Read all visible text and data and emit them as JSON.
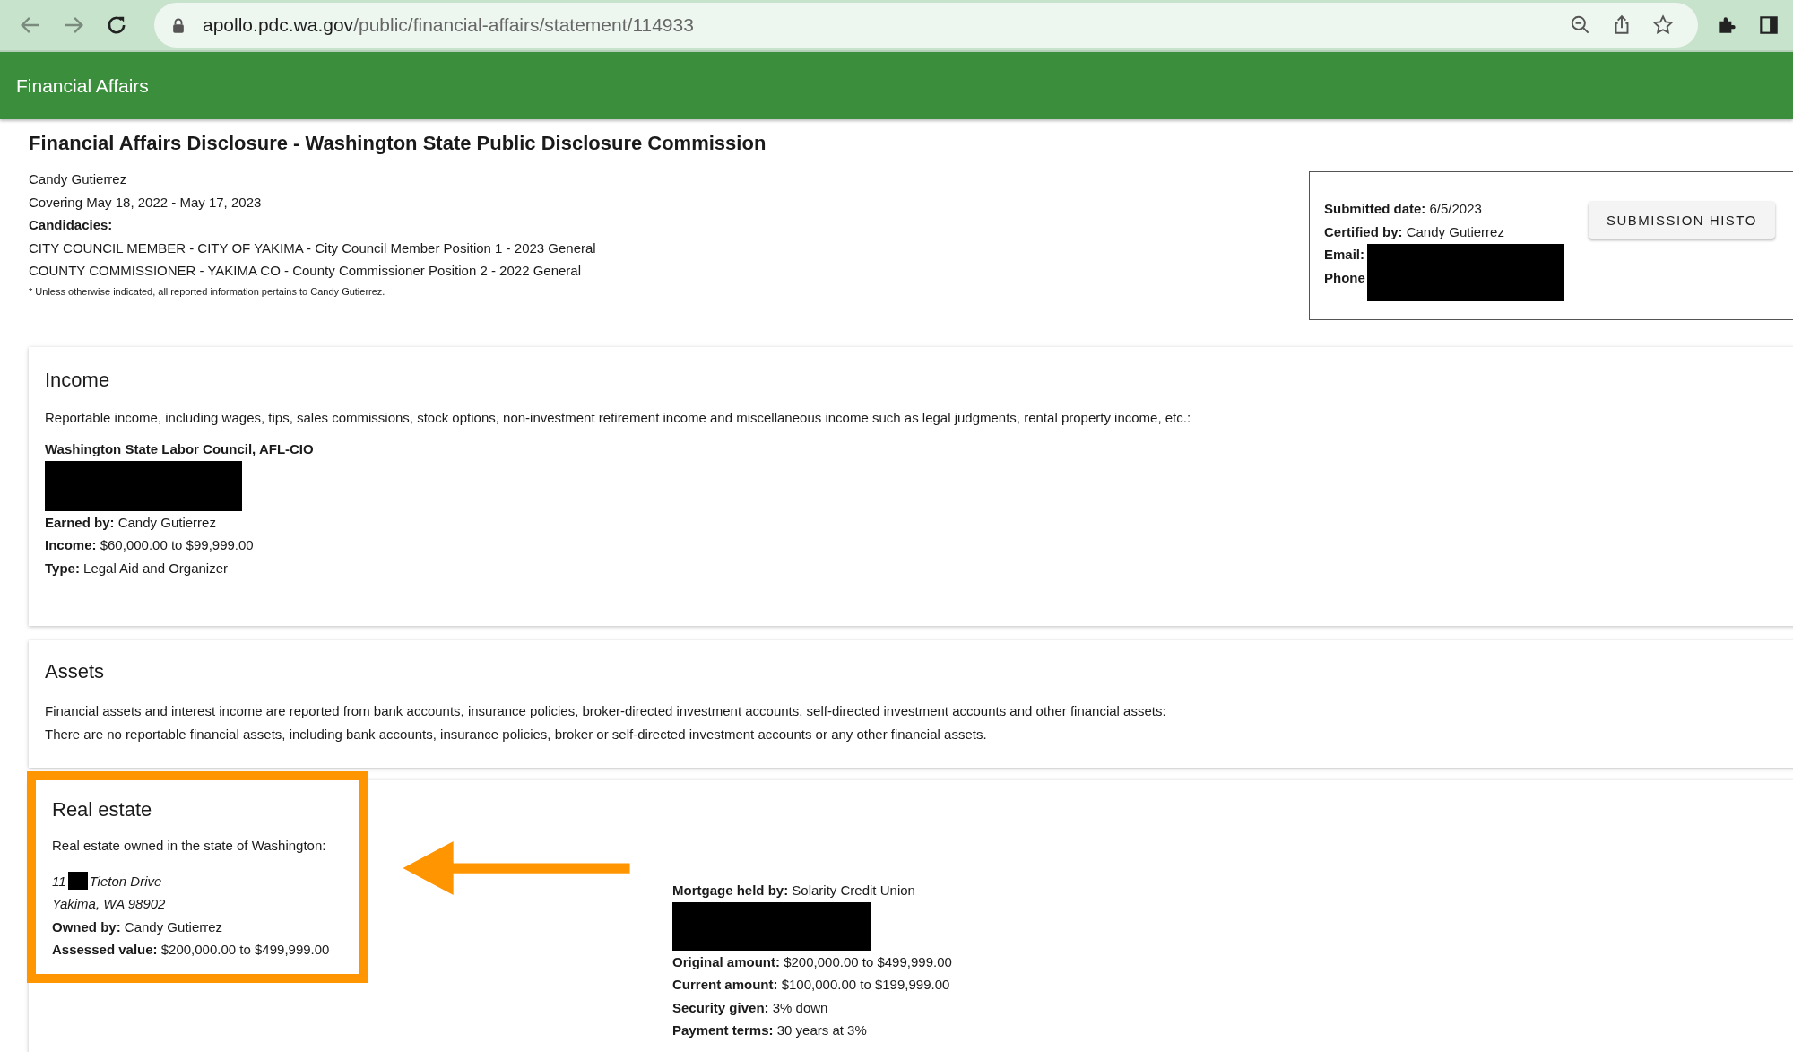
{
  "browser": {
    "url_host": "apollo.pdc.wa.gov",
    "url_path": "/public/financial-affairs/statement/114933"
  },
  "app_bar": {
    "title": "Financial Affairs"
  },
  "page_title": "Financial Affairs Disclosure - Washington State Public Disclosure Commission",
  "filer": {
    "name": "Candy Gutierrez",
    "period": "Covering May 18, 2022 - May 17, 2023",
    "candidacies_label": "Candidacies:",
    "candidacies": [
      "CITY COUNCIL MEMBER - CITY OF YAKIMA - City Council Member Position 1 - 2023 General",
      "COUNTY COMMISSIONER - YAKIMA CO - County Commissioner Position 2 - 2022 General"
    ],
    "note": "* Unless otherwise indicated, all reported information pertains to Candy Gutierrez."
  },
  "submission": {
    "lines": [
      "**Submitted date:** 6/5/2023",
      "**Certified by:** Candy Gutierrez",
      "**Email:**",
      "**Phone**"
    ],
    "button": "SUBMISSION HISTO"
  },
  "income": {
    "heading": "Income",
    "description": "Reportable income, including wages, tips, sales commissions, stock options, non-investment retirement income and miscellaneous income such as legal judgments, rental property income, etc.:",
    "entries": [
      {
        "source": "Washington State Labor Council, AFL-CIO",
        "redacted": true,
        "lines": [
          "**Earned by:** Candy Gutierrez",
          "**Income:** $60,000.00 to $99,999.00",
          "**Type:** Legal Aid and Organizer"
        ]
      }
    ]
  },
  "assets": {
    "heading": "Assets",
    "lines": [
      "Financial assets and interest income are reported from bank accounts, insurance policies, broker-directed investment accounts, self-directed investment accounts and other financial assets:",
      "There are no reportable financial assets, including bank accounts, insurance policies, broker or self-directed investment accounts or any other financial assets."
    ]
  },
  "real_estate": {
    "heading": "Real estate",
    "description": "Real estate owned in the state of Washington:",
    "highlighted": true,
    "address_number": "11",
    "address_street": "Tieton Drive",
    "address_city": "Yakima, WA 98902",
    "lines": [
      "**Owned by:** Candy Gutierrez",
      "**Assessed value:** $200,000.00 to $499,999.00"
    ],
    "mortgage_held_by": "**Mortgage held by:** Solarity Credit Union",
    "mortgage_lines": [
      "**Original amount:** $200,000.00 to $499,999.00",
      "**Current amount:** $100,000.00 to $199,999.00",
      "**Security given:** 3% down",
      "**Payment terms:** 30 years at 3%"
    ]
  }
}
